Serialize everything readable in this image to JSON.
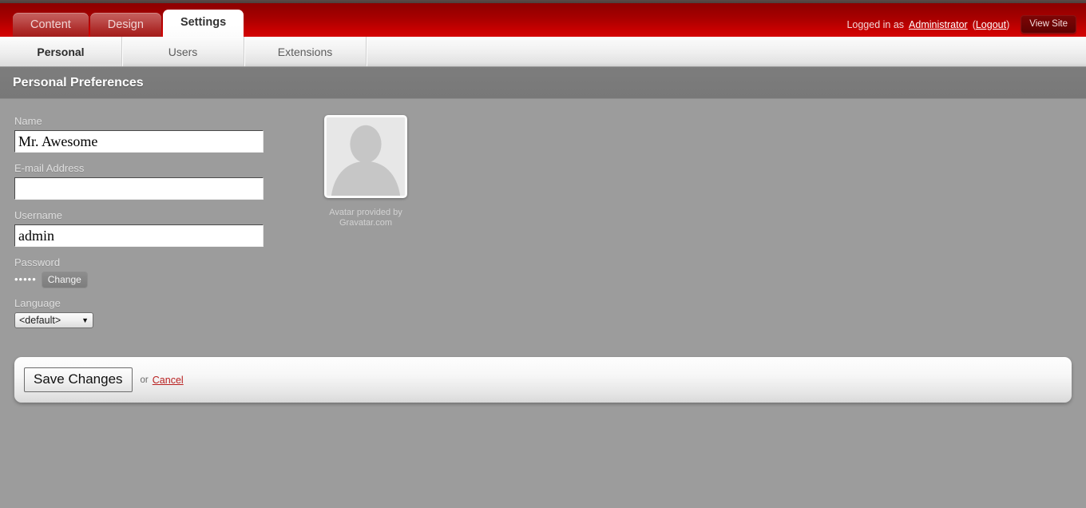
{
  "header": {
    "main_tabs": [
      {
        "label": "Content",
        "active": false
      },
      {
        "label": "Design",
        "active": false
      },
      {
        "label": "Settings",
        "active": true
      }
    ],
    "logged_in_prefix": "Logged in as",
    "logged_in_user": "Administrator",
    "logout_open": "(",
    "logout_label": "Logout",
    "logout_close": ")",
    "view_site_label": "View Site",
    "accent_color": "#c70000",
    "header_dark_color": "#8c0000"
  },
  "sub_nav": {
    "tabs": [
      {
        "label": "Personal",
        "active": true
      },
      {
        "label": "Users",
        "active": false
      },
      {
        "label": "Extensions",
        "active": false
      }
    ]
  },
  "page": {
    "title": "Personal Preferences",
    "title_bar_color": "#7d7d7d",
    "background_color": "#9c9c9c"
  },
  "form": {
    "name": {
      "label": "Name",
      "value": "Mr. Awesome",
      "placeholder": ""
    },
    "email": {
      "label": "E-mail Address",
      "value": "",
      "placeholder": ""
    },
    "username": {
      "label": "Username",
      "value": "admin",
      "placeholder": ""
    },
    "password": {
      "label": "Password",
      "masked_value": "•••••",
      "change_label": "Change"
    },
    "language": {
      "label": "Language",
      "selected": "<default>",
      "options": [
        "<default>"
      ]
    }
  },
  "avatar": {
    "caption_line1": "Avatar provided by",
    "caption_line2": "Gravatar.com",
    "alt": "default-user-silhouette"
  },
  "actions": {
    "save_label": "Save Changes",
    "or_label": "or",
    "cancel_label": "Cancel",
    "cancel_color": "#b92020"
  }
}
